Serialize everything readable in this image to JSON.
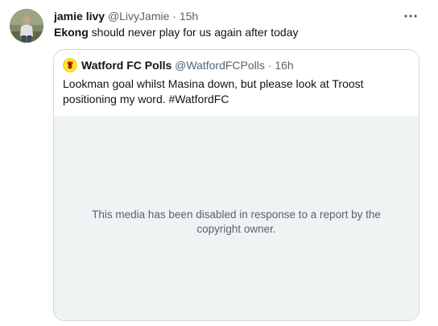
{
  "tweet": {
    "author_name": "jamie livy",
    "author_handle": "@LivyJamie",
    "separator": "·",
    "timestamp": "15h",
    "text_bold": "Ekong",
    "text_rest": " should never play for us again after today",
    "more_icon": "more-horizontal-icon"
  },
  "quoted_tweet": {
    "author_name": "Watford FC Polls",
    "author_handle": "@WatfordFCPolls",
    "separator": "·",
    "timestamp": "16h",
    "text": "Lookman goal whilst Masina down, but please look at Troost positioning my word. #WatfordFC",
    "media_notice": "This media has been disabled in response to a report by the copyright owner."
  },
  "colors": {
    "text_primary": "#0f1419",
    "text_secondary": "#536471",
    "border": "#cfd9de",
    "media_bg": "#eff3f4",
    "watford_yellow": "#fbee23"
  }
}
